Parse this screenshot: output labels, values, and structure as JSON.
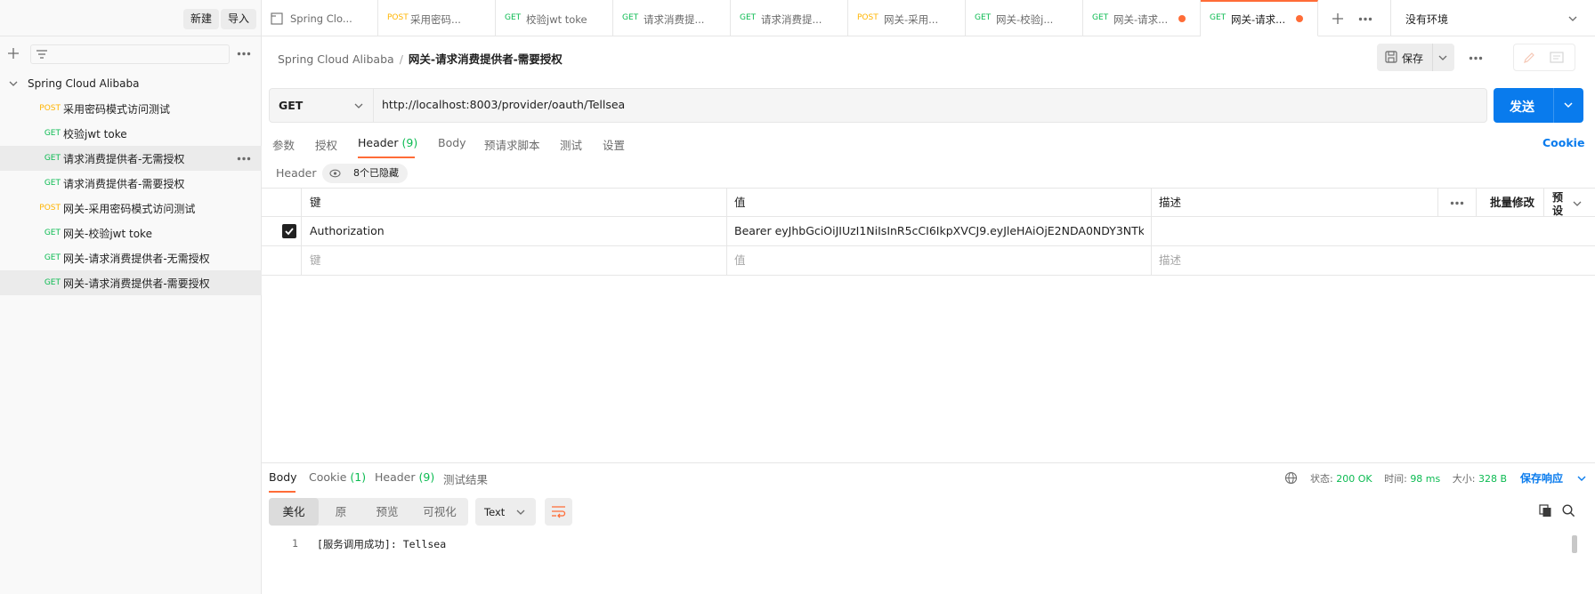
{
  "sidebar": {
    "new_label": "新建",
    "import_label": "导入",
    "collection_name": "Spring Cloud Alibaba",
    "items": [
      {
        "method": "POST",
        "label": "采用密码模式访问测试"
      },
      {
        "method": "GET",
        "label": "校验jwt toke"
      },
      {
        "method": "GET",
        "label": "请求消费提供者-无需授权"
      },
      {
        "method": "GET",
        "label": "请求消费提供者-需要授权"
      },
      {
        "method": "POST",
        "label": "网关-采用密码模式访问测试"
      },
      {
        "method": "GET",
        "label": "网关-校验jwt toke"
      },
      {
        "method": "GET",
        "label": "网关-请求消费提供者-无需授权"
      },
      {
        "method": "GET",
        "label": "网关-请求消费提供者-需要授权"
      }
    ]
  },
  "tabs": [
    {
      "method": "",
      "label": "Spring Clo..."
    },
    {
      "method": "POST",
      "label": "采用密码..."
    },
    {
      "method": "GET",
      "label": "校验jwt toke"
    },
    {
      "method": "GET",
      "label": "请求消费提..."
    },
    {
      "method": "GET",
      "label": "请求消费提..."
    },
    {
      "method": "POST",
      "label": "网关-采用..."
    },
    {
      "method": "GET",
      "label": "网关-校验j..."
    },
    {
      "method": "GET",
      "label": "网关-请求..."
    },
    {
      "method": "GET",
      "label": "网关-请求..."
    }
  ],
  "environment": "没有环境",
  "breadcrumb": {
    "collection": "Spring Cloud Alibaba",
    "separator": "/",
    "request": "网关-请求消费提供者-需要授权"
  },
  "save_label": "保存",
  "request": {
    "method": "GET",
    "url": "http://localhost:8003/provider/oauth/Tellsea",
    "send_label": "发送"
  },
  "request_tabs": {
    "params": "参数",
    "auth": "授权",
    "header": "Header",
    "header_count": "(9)",
    "body": "Body",
    "prerequest": "预请求脚本",
    "tests": "测试",
    "settings": "设置",
    "cookie": "Cookie"
  },
  "headers_section": {
    "title": "Header",
    "hidden": "8个已隐藏",
    "columns": {
      "key": "键",
      "value": "值",
      "desc": "描述",
      "bulk": "批量修改",
      "preset": "预设"
    },
    "rows": [
      {
        "checked": true,
        "key": "Authorization",
        "value": "Bearer eyJhbGciOiJIUzI1NiIsInR5cCI6IkpXVCJ9.eyJleHAiOjE2NDA0NDY3NTk",
        "desc": ""
      }
    ],
    "placeholder": {
      "key": "键",
      "value": "值",
      "desc": "描述"
    }
  },
  "response": {
    "tabs": {
      "body": "Body",
      "cookie": "Cookie",
      "cookie_count": "(1)",
      "header": "Header",
      "header_count": "(9)",
      "tests": "测试结果"
    },
    "status_label": "状态:",
    "status": "200 OK",
    "time_label": "时间:",
    "time": "98 ms",
    "size_label": "大小:",
    "size": "328 B",
    "save_label": "保存响应",
    "views": [
      "美化",
      "原",
      "预览",
      "可视化"
    ],
    "format": "Text",
    "line_number": "1",
    "body_text": "[服务调用成功]: Tellsea"
  },
  "colors": {
    "accent": "#ff6c37",
    "primary": "#097bed",
    "get": "#0cbb52",
    "post": "#ffb400"
  }
}
